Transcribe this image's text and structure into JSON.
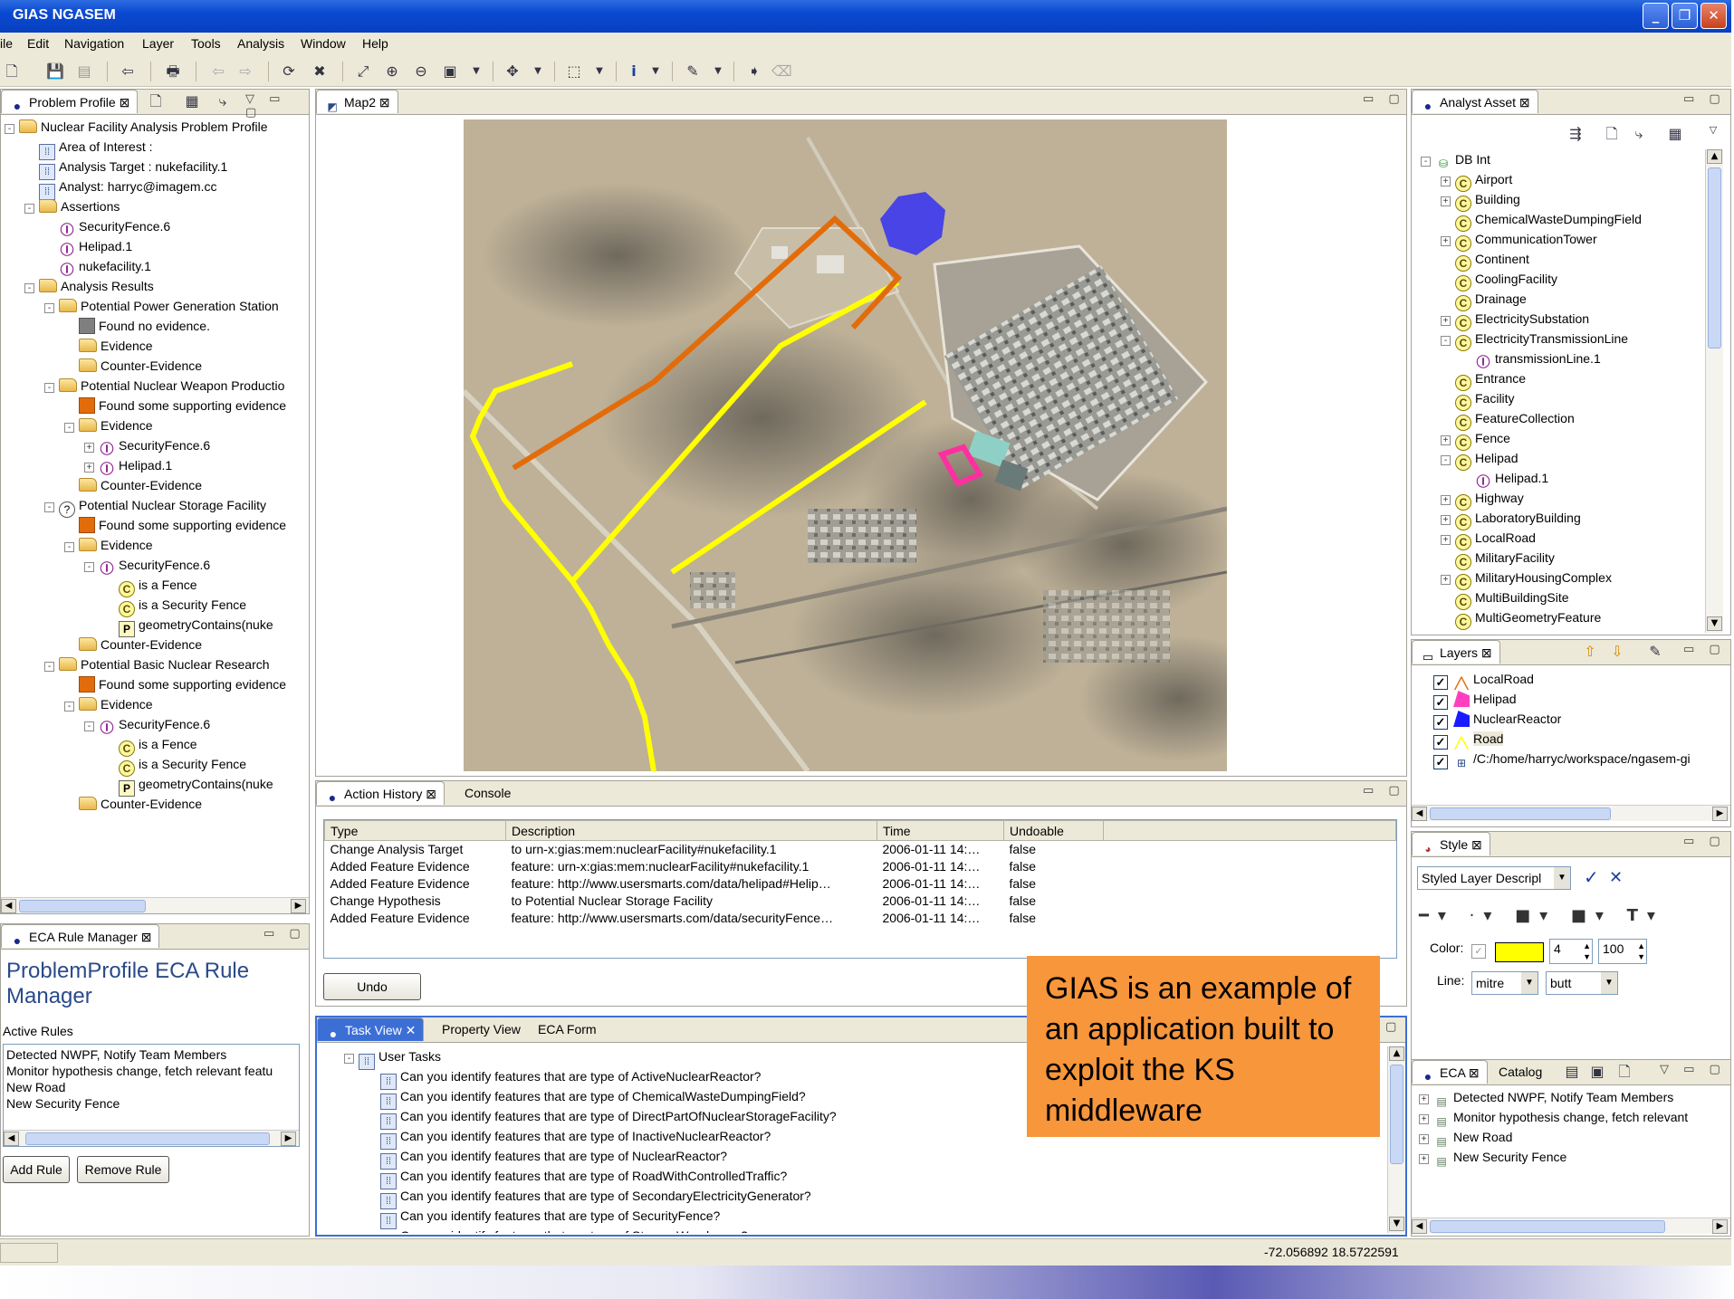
{
  "window": {
    "title": "GIAS NGASEM"
  },
  "menu": [
    "ile",
    "Edit",
    "Navigation",
    "Layer",
    "Tools",
    "Analysis",
    "Window",
    "Help"
  ],
  "problem_profile": {
    "tab": "Problem Profile",
    "rows": [
      {
        "d": 0,
        "i": "folder",
        "t": "Nuclear Facility Analysis Problem Profile",
        "pm": "-"
      },
      {
        "d": 1,
        "i": "ai",
        "t": "Area of Interest :"
      },
      {
        "d": 1,
        "i": "ai",
        "t": "Analysis Target : nukefacility.1"
      },
      {
        "d": 1,
        "i": "ai",
        "t": "Analyst: harryc@imagem.cc"
      },
      {
        "d": 1,
        "i": "folder",
        "t": "Assertions",
        "pm": "-"
      },
      {
        "d": 2,
        "i": "inst",
        "t": "SecurityFence.6"
      },
      {
        "d": 2,
        "i": "inst",
        "t": "Helipad.1"
      },
      {
        "d": 2,
        "i": "inst",
        "t": "nukefacility.1"
      },
      {
        "d": 1,
        "i": "folder",
        "t": "Analysis Results",
        "pm": "-"
      },
      {
        "d": 2,
        "i": "folder",
        "t": "Potential Power Generation Station",
        "pm": "-"
      },
      {
        "d": 3,
        "i": "ev-gray",
        "t": "Found no evidence."
      },
      {
        "d": 3,
        "i": "folder",
        "t": "Evidence"
      },
      {
        "d": 3,
        "i": "folder",
        "t": "Counter-Evidence"
      },
      {
        "d": 2,
        "i": "folder",
        "t": "Potential Nuclear Weapon Productio",
        "pm": "-"
      },
      {
        "d": 3,
        "i": "ev-orange",
        "t": "Found some supporting evidence"
      },
      {
        "d": 3,
        "i": "folder",
        "t": "Evidence",
        "pm": "-"
      },
      {
        "d": 4,
        "i": "inst",
        "t": "SecurityFence.6",
        "pm": "+"
      },
      {
        "d": 4,
        "i": "inst",
        "t": "Helipad.1",
        "pm": "+"
      },
      {
        "d": 3,
        "i": "folder",
        "t": "Counter-Evidence"
      },
      {
        "d": 2,
        "i": "qm",
        "t": "Potential Nuclear Storage Facility",
        "pm": "-"
      },
      {
        "d": 3,
        "i": "ev-orange",
        "t": "Found some supporting evidence"
      },
      {
        "d": 3,
        "i": "folder",
        "t": "Evidence",
        "pm": "-"
      },
      {
        "d": 4,
        "i": "inst",
        "t": "SecurityFence.6",
        "pm": "-"
      },
      {
        "d": 5,
        "i": "cls",
        "t": "is a Fence"
      },
      {
        "d": 5,
        "i": "cls",
        "t": "is a Security Fence"
      },
      {
        "d": 5,
        "i": "prop",
        "t": "geometryContains(nuke"
      },
      {
        "d": 3,
        "i": "folder",
        "t": "Counter-Evidence"
      },
      {
        "d": 2,
        "i": "folder",
        "t": "Potential Basic Nuclear Research",
        "pm": "-"
      },
      {
        "d": 3,
        "i": "ev-orange",
        "t": "Found some supporting evidence"
      },
      {
        "d": 3,
        "i": "folder",
        "t": "Evidence",
        "pm": "-"
      },
      {
        "d": 4,
        "i": "inst",
        "t": "SecurityFence.6",
        "pm": "-"
      },
      {
        "d": 5,
        "i": "cls",
        "t": "is a Fence"
      },
      {
        "d": 5,
        "i": "cls",
        "t": "is a Security Fence"
      },
      {
        "d": 5,
        "i": "prop",
        "t": "geometryContains(nuke"
      },
      {
        "d": 3,
        "i": "folder",
        "t": "Counter-Evidence"
      }
    ]
  },
  "eca_manager": {
    "tab": "ECA Rule Manager",
    "title": "ProblemProfile ECA Rule Manager",
    "active_label": "Active Rules",
    "rules": [
      "Detected NWPF, Notify Team Members",
      "Monitor hypothesis change, fetch relevant featu",
      "New Road",
      "New Security Fence"
    ],
    "add": "Add Rule",
    "remove": "Remove Rule"
  },
  "map": {
    "tab": "Map2"
  },
  "action_history": {
    "tabs": [
      "Action History",
      "Console"
    ],
    "columns": [
      "Type",
      "Description",
      "Time",
      "Undoable"
    ],
    "rows": [
      [
        "Change Analysis Target",
        "to urn-x:gias:mem:nuclearFacility#nukefacility.1",
        "2006-01-11 14:…",
        "false"
      ],
      [
        "Added Feature Evidence",
        "feature: urn-x:gias:mem:nuclearFacility#nukefacility.1",
        "2006-01-11 14:…",
        "false"
      ],
      [
        "Added Feature Evidence",
        "feature: http://www.usersmarts.com/data/helipad#Helip…",
        "2006-01-11 14:…",
        "false"
      ],
      [
        "Change Hypothesis",
        "to Potential Nuclear Storage Facility",
        "2006-01-11 14:…",
        "false"
      ],
      [
        "Added Feature Evidence",
        "feature: http://www.usersmarts.com/data/securityFence…",
        "2006-01-11 14:…",
        "false"
      ]
    ],
    "undo": "Undo"
  },
  "tasks": {
    "tabs": [
      "Task View",
      "Property View",
      "ECA Form"
    ],
    "root": "User Tasks",
    "items": [
      "Can you identify features that are type of ActiveNuclearReactor?",
      "Can you identify features that are type of ChemicalWasteDumpingField?",
      "Can you identify features that are type of DirectPartOfNuclearStorageFacility?",
      "Can you identify features that are type of InactiveNuclearReactor?",
      "Can you identify features that are type of NuclearReactor?",
      "Can you identify features that are type of RoadWithControlledTraffic?",
      "Can you identify features that are type of SecondaryElectricityGenerator?",
      "Can you identify features that are type of SecurityFence?",
      "Can you identify features that are type of StorageWarehouse?"
    ]
  },
  "callout": "GIAS is an example of an application built to exploit the KS middleware",
  "analyst_asset": {
    "tab": "Analyst Asset",
    "rows": [
      {
        "d": 0,
        "i": "db",
        "t": "DB Int",
        "pm": "-"
      },
      {
        "d": 1,
        "i": "cls",
        "t": "Airport",
        "pm": "+"
      },
      {
        "d": 1,
        "i": "cls",
        "t": "Building",
        "pm": "+"
      },
      {
        "d": 1,
        "i": "cls",
        "t": "ChemicalWasteDumpingField"
      },
      {
        "d": 1,
        "i": "cls",
        "t": "CommunicationTower",
        "pm": "+"
      },
      {
        "d": 1,
        "i": "cls",
        "t": "Continent"
      },
      {
        "d": 1,
        "i": "cls",
        "t": "CoolingFacility"
      },
      {
        "d": 1,
        "i": "cls",
        "t": "Drainage"
      },
      {
        "d": 1,
        "i": "cls",
        "t": "ElectricitySubstation",
        "pm": "+"
      },
      {
        "d": 1,
        "i": "cls",
        "t": "ElectricityTransmissionLine",
        "pm": "-"
      },
      {
        "d": 2,
        "i": "inst",
        "t": "transmissionLine.1"
      },
      {
        "d": 1,
        "i": "cls",
        "t": "Entrance"
      },
      {
        "d": 1,
        "i": "cls",
        "t": "Facility"
      },
      {
        "d": 1,
        "i": "cls",
        "t": "FeatureCollection"
      },
      {
        "d": 1,
        "i": "cls",
        "t": "Fence",
        "pm": "+"
      },
      {
        "d": 1,
        "i": "cls",
        "t": "Helipad",
        "pm": "-"
      },
      {
        "d": 2,
        "i": "inst",
        "t": "Helipad.1"
      },
      {
        "d": 1,
        "i": "cls",
        "t": "Highway",
        "pm": "+"
      },
      {
        "d": 1,
        "i": "cls",
        "t": "LaboratoryBuilding",
        "pm": "+"
      },
      {
        "d": 1,
        "i": "cls",
        "t": "LocalRoad",
        "pm": "+"
      },
      {
        "d": 1,
        "i": "cls",
        "t": "MilitaryFacility"
      },
      {
        "d": 1,
        "i": "cls",
        "t": "MilitaryHousingComplex",
        "pm": "+"
      },
      {
        "d": 1,
        "i": "cls",
        "t": "MultiBuildingSite"
      },
      {
        "d": 1,
        "i": "cls",
        "t": "MultiGeometryFeature"
      }
    ]
  },
  "layers": {
    "tab": "Layers",
    "items": [
      {
        "t": "LocalRoad",
        "sym": "line",
        "color": "#e36c0a"
      },
      {
        "t": "Helipad",
        "sym": "poly",
        "color": "#ff3fbf"
      },
      {
        "t": "NuclearReactor",
        "sym": "poly",
        "color": "#1a1aff"
      },
      {
        "t": "Road",
        "sym": "line",
        "color": "#ffff00"
      },
      {
        "t": "/C:/home/harryc/workspace/ngasem-gi",
        "sym": "grid",
        "color": "#2a4a8a"
      }
    ]
  },
  "style": {
    "tab": "Style",
    "descriptor": "Styled Layer Descripl",
    "color_label": "Color:",
    "width": "4",
    "opacity": "100",
    "line_label": "Line:",
    "join": "mitre",
    "cap": "butt",
    "fill_color": "#ffff00"
  },
  "eca": {
    "tabs": [
      "ECA",
      "Catalog"
    ],
    "items": [
      "Detected NWPF, Notify Team Members",
      "Monitor hypothesis change, fetch relevant",
      "New Road",
      "New Security Fence"
    ]
  },
  "status": {
    "coords": "-72.056892 18.5722591"
  }
}
